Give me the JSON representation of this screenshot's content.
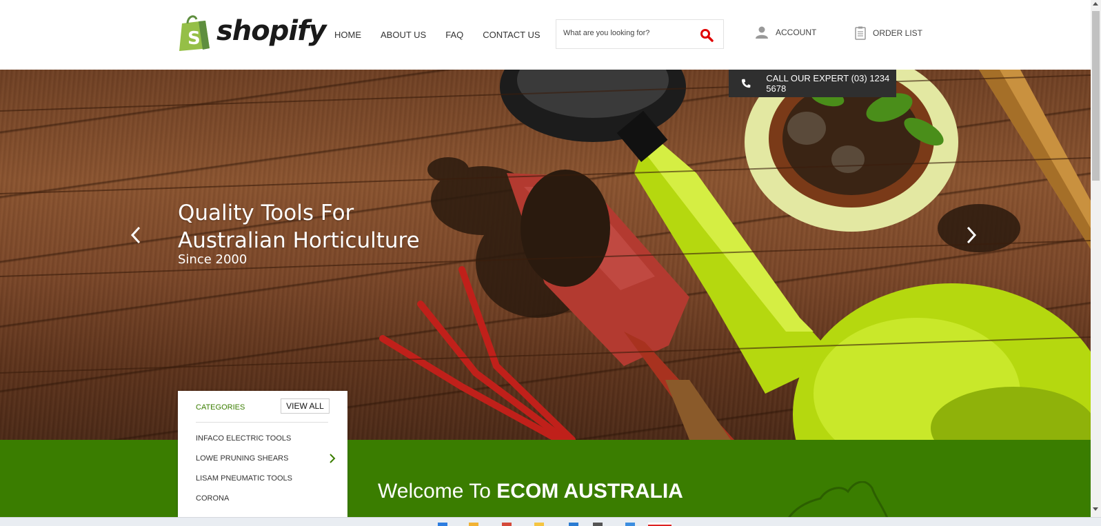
{
  "header": {
    "logo_text": "shopify",
    "nav": [
      {
        "label": "HOME"
      },
      {
        "label": "ABOUT US"
      },
      {
        "label": "FAQ"
      },
      {
        "label": "CONTACT US"
      }
    ],
    "search": {
      "placeholder": "What are you looking for?",
      "icon": "search-icon"
    },
    "account_label": "ACCOUNT",
    "order_list_label": "ORDER LIST"
  },
  "call_expert": "CALL OUR EXPERT (03) 1234 5678",
  "hero": {
    "title_line1": "Quality Tools For",
    "title_line2": "Australian Horticulture",
    "subtitle": "Since 2000"
  },
  "categories": {
    "heading": "CATEGORIES",
    "view_all": "VIEW ALL",
    "items": [
      {
        "label": "INFACO ELECTRIC TOOLS"
      },
      {
        "label": "LOWE PRUNING SHEARS"
      },
      {
        "label": "LISAM PNEUMATIC TOOLS"
      },
      {
        "label": "CORONA"
      }
    ]
  },
  "welcome": {
    "prefix": "Welcome To ",
    "brand": "ECOM AUSTRALIA"
  },
  "colors": {
    "accent_green": "#3a7d00",
    "search_red": "#e00000",
    "call_bar": "#2f2f2f"
  }
}
